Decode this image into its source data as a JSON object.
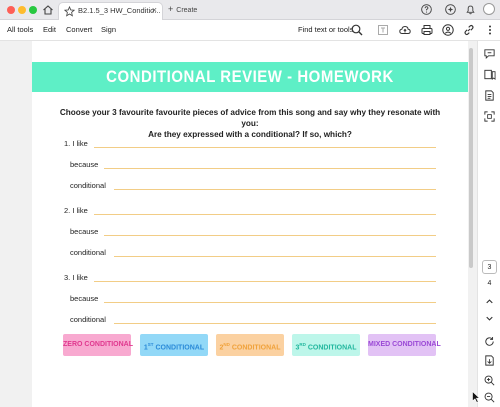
{
  "window": {
    "tab_title": "B2.1.5_3 HW_Conditio...",
    "tab_close": "×",
    "new_tab_plus": "+",
    "new_tab_label": "Create"
  },
  "toolbar": {
    "menus": [
      "All tools",
      "Edit",
      "Convert",
      "Sign"
    ],
    "find_label": "Find text or tools"
  },
  "document": {
    "title": "CONDITIONAL REVIEW - HOMEWORK",
    "instructions_line1": "Choose your 3 favourite favourite pieces of advice from this song and say why they resonate with you:",
    "instructions_line2": "Are they expressed with a conditional? If so, which?",
    "items": [
      {
        "i_like": "1. I like",
        "because": "because",
        "conditional": "conditional"
      },
      {
        "i_like": "2. I like",
        "because": "because",
        "conditional": "conditional"
      },
      {
        "i_like": "3. I like",
        "because": "because",
        "conditional": "conditional"
      }
    ],
    "tags": [
      {
        "label": "ZERO CONDITIONAL",
        "bg": "#f8a9d0",
        "fg": "#e0398f"
      },
      {
        "ord": "1",
        "sup": "ST",
        "rest": " CONDITIONAL",
        "bg": "#92d8f7",
        "fg": "#2a8ad8"
      },
      {
        "ord": "2",
        "sup": "ND",
        "rest": " CONDITIONAL",
        "bg": "#fbd1a1",
        "fg": "#f0a23b"
      },
      {
        "ord": "3",
        "sup": "RD",
        "rest": " CONDITIONAL",
        "bg": "#bdf6ea",
        "fg": "#22b79e"
      },
      {
        "label": "MIXED CONDITIONAL",
        "bg": "#e2c2f5",
        "fg": "#9b49d6"
      }
    ]
  },
  "sidebar": {
    "pages": [
      "3",
      "4"
    ],
    "current_page": "3"
  },
  "colors": {
    "banner": "#5eefc6",
    "answer_line": "#f2cd86"
  }
}
